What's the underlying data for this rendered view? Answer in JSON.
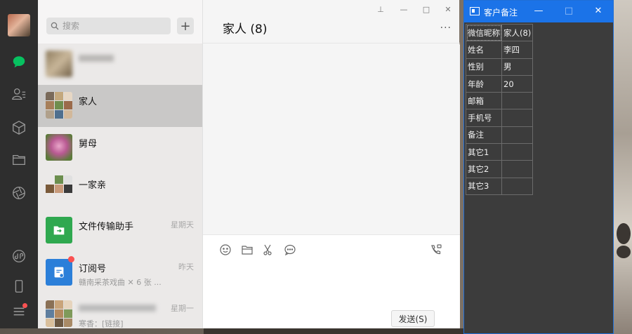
{
  "search": {
    "placeholder": "搜索",
    "add_label": "+"
  },
  "chats": [
    {
      "name": "",
      "time": "",
      "preview": "",
      "blurred": true
    },
    {
      "name": "家人",
      "time": "",
      "preview": "",
      "active": true
    },
    {
      "name": "舅母",
      "time": "",
      "preview": ""
    },
    {
      "name": "一家亲",
      "time": "",
      "preview": ""
    },
    {
      "name": "文件传输助手",
      "time": "星期天",
      "preview": ""
    },
    {
      "name": "订阅号",
      "time": "昨天",
      "preview": "赣南采茶戏曲 ✕ 6 张 ..."
    },
    {
      "name": "",
      "time": "星期一",
      "preview": "寒香：[链接]"
    }
  ],
  "chat": {
    "title": "家人 (8)",
    "more": "···",
    "send_label": "发送(S)"
  },
  "window": {
    "pin": "⊥",
    "minimize": "—",
    "maximize": "□",
    "close": "✕"
  },
  "notes": {
    "title": "客户备注",
    "minimize": "—",
    "maximize": "□",
    "close": "✕",
    "rows": [
      {
        "key": "微信昵称",
        "value": "家人(8)"
      },
      {
        "key": "姓名",
        "value": "李四"
      },
      {
        "key": "性别",
        "value": "男"
      },
      {
        "key": "年龄",
        "value": "20"
      },
      {
        "key": "邮箱",
        "value": ""
      },
      {
        "key": "手机号",
        "value": ""
      },
      {
        "key": "备注",
        "value": ""
      },
      {
        "key": "其它1",
        "value": ""
      },
      {
        "key": "其它2",
        "value": ""
      },
      {
        "key": "其它3",
        "value": ""
      }
    ]
  },
  "colors": {
    "wechat_green": "#07c160",
    "notes_blue": "#1b73e8",
    "sidebar": "#2e2e2e",
    "badge": "#fa5151"
  }
}
